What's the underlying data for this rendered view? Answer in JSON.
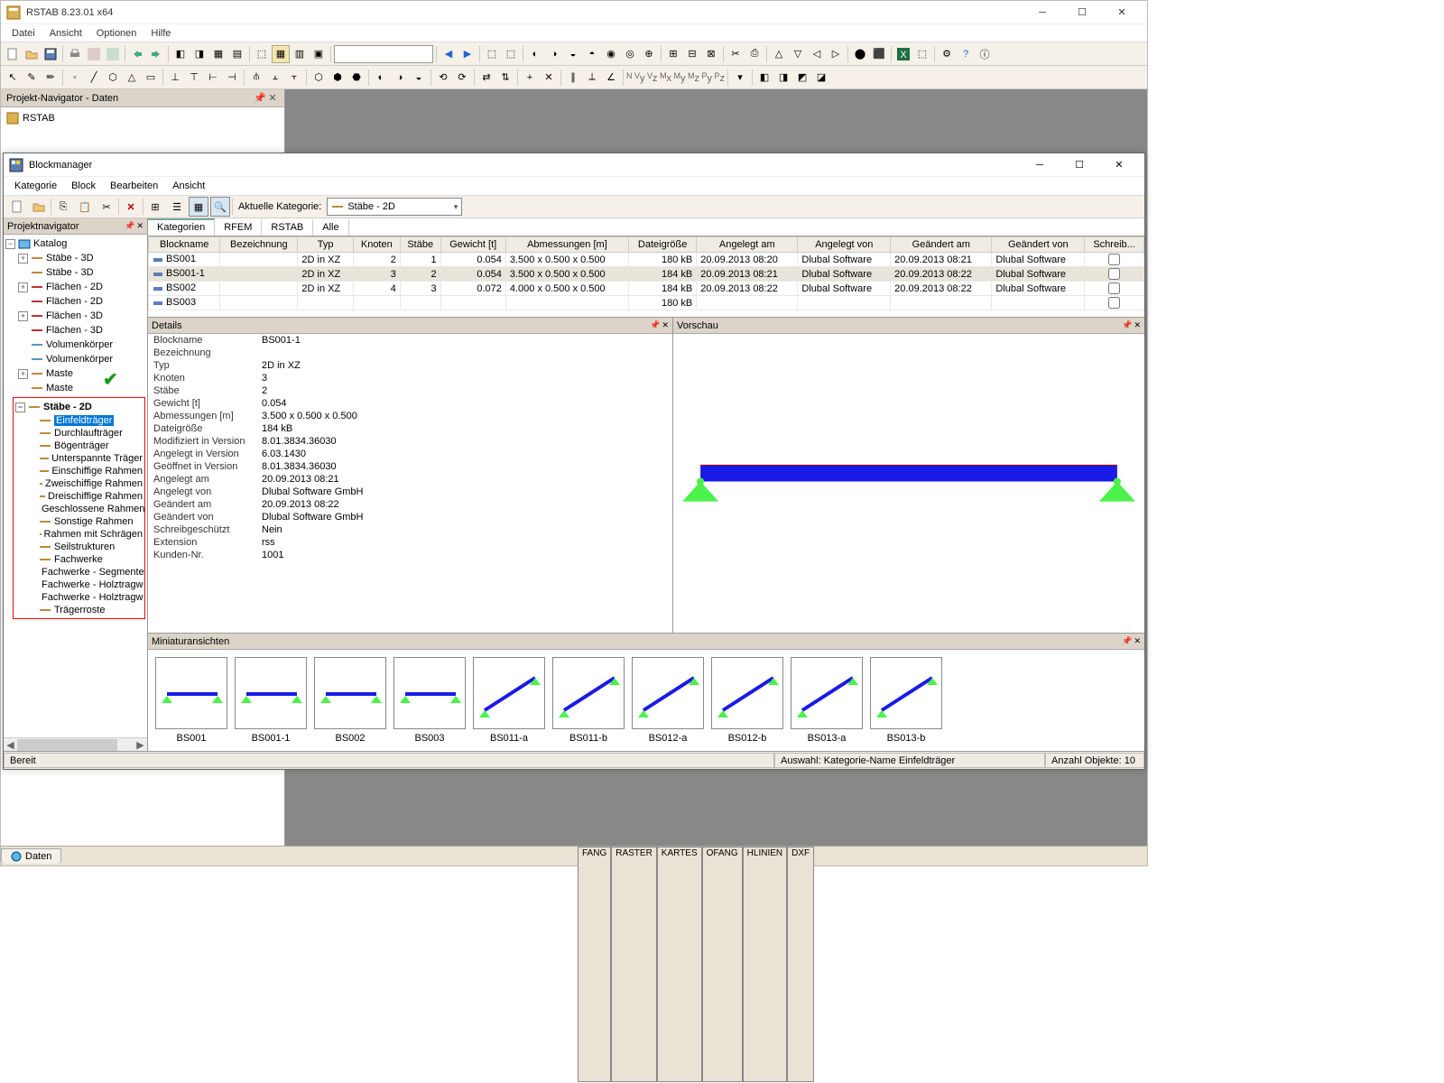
{
  "app": {
    "title": "RSTAB 8.23.01 x64",
    "menus": [
      "Datei",
      "Ansicht",
      "Optionen",
      "Hilfe"
    ],
    "navigator_title": "Projekt-Navigator - Daten",
    "nav_root": "RSTAB",
    "footer_tab": "Daten",
    "status_toggles": [
      "FANG",
      "RASTER",
      "KARTES",
      "OFANG",
      "HLINIEN",
      "DXF"
    ]
  },
  "bm": {
    "title": "Blockmanager",
    "menus": [
      "Kategorie",
      "Block",
      "Bearbeiten",
      "Ansicht"
    ],
    "toolbar_label": "Aktuelle Kategorie:",
    "toolbar_category": "Stäbe - 2D",
    "left_header": "Projektnavigator",
    "tree_root": "Katalog",
    "tree": [
      {
        "exp": "+",
        "label": "Stäbe - 3D",
        "color": "#c08a3a"
      },
      {
        "exp": "",
        "label": "Stäbe - 3D",
        "color": "#c08a3a"
      },
      {
        "exp": "+",
        "label": "Flächen - 2D",
        "color": "#b33"
      },
      {
        "exp": "",
        "label": "Flächen - 2D",
        "color": "#b33"
      },
      {
        "exp": "+",
        "label": "Flächen - 3D",
        "color": "#b33"
      },
      {
        "exp": "",
        "label": "Flächen - 3D",
        "color": "#b33"
      },
      {
        "exp": "",
        "label": "Volumenkörper",
        "color": "#59b"
      },
      {
        "exp": "",
        "label": "Volumenkörper",
        "color": "#59b"
      },
      {
        "exp": "+",
        "label": "Maste",
        "color": "#c08a3a"
      },
      {
        "exp": "",
        "label": "Maste",
        "color": "#c08a3a"
      }
    ],
    "red_group_label": "Stäbe - 2D",
    "red_group": [
      {
        "label": "Einfeldträger",
        "selected": true
      },
      {
        "label": "Durchlaufträger"
      },
      {
        "label": "Bögenträger"
      },
      {
        "label": "Unterspannte Träger"
      },
      {
        "label": "Einschiffige Rahmen"
      },
      {
        "label": "Zweischiffige Rahmen"
      },
      {
        "label": "Dreischiffige Rahmen"
      },
      {
        "label": "Geschlossene Rahmen"
      },
      {
        "label": "Sonstige Rahmen"
      },
      {
        "label": "Rahmen mit Schrägen"
      },
      {
        "label": "Seilstrukturen"
      },
      {
        "label": "Fachwerke"
      },
      {
        "label": "Fachwerke - Segmente"
      },
      {
        "label": "Fachwerke - Holztragw"
      },
      {
        "label": "Fachwerke - Holztragw"
      },
      {
        "label": "Trägerroste"
      }
    ],
    "tabs": [
      "Kategorien",
      "RFEM",
      "RSTAB",
      "Alle"
    ],
    "active_tab": 0,
    "grid_headers": [
      "Blockname",
      "Bezeichnung",
      "Typ",
      "Knoten",
      "Stäbe",
      "Gewicht [t]",
      "Abmessungen [m]",
      "Dateigröße",
      "Angelegt am",
      "Angelegt von",
      "Geändert am",
      "Geändert von",
      "Schreib..."
    ],
    "grid_rows": [
      {
        "name": "BS001",
        "typ": "2D in XZ",
        "knoten": "2",
        "stabe": "1",
        "gew": "0.054",
        "abm": "3.500 x 0.500 x 0.500",
        "size": "180 kB",
        "c_am": "20.09.2013 08:20",
        "c_von": "Dlubal Software",
        "m_am": "20.09.2013 08:21",
        "m_von": "Dlubal Software"
      },
      {
        "name": "BS001-1",
        "typ": "2D in XZ",
        "knoten": "3",
        "stabe": "2",
        "gew": "0.054",
        "abm": "3.500 x 0.500 x 0.500",
        "size": "184 kB",
        "c_am": "20.09.2013 08:21",
        "c_von": "Dlubal Software",
        "m_am": "20.09.2013 08:22",
        "m_von": "Dlubal Software",
        "sel": true
      },
      {
        "name": "BS002",
        "typ": "2D in XZ",
        "knoten": "4",
        "stabe": "3",
        "gew": "0.072",
        "abm": "4.000 x 0.500 x 0.500",
        "size": "184 kB",
        "c_am": "20.09.2013 08:22",
        "c_von": "Dlubal Software",
        "m_am": "20.09.2013 08:22",
        "m_von": "Dlubal Software"
      },
      {
        "name": "BS003",
        "typ": "",
        "knoten": "",
        "stabe": "",
        "gew": "",
        "abm": "",
        "size": "180 kB",
        "c_am": "",
        "c_von": "",
        "m_am": "",
        "m_von": ""
      }
    ],
    "details_header": "Details",
    "details": [
      [
        "Blockname",
        "BS001-1"
      ],
      [
        "Bezeichnung",
        ""
      ],
      [
        "Typ",
        "2D in XZ"
      ],
      [
        "Knoten",
        "3"
      ],
      [
        "Stäbe",
        "2"
      ],
      [
        "Gewicht [t]",
        "0.054"
      ],
      [
        "Abmessungen [m]",
        "3.500 x 0.500 x 0.500"
      ],
      [
        "Dateigröße",
        "184 kB"
      ],
      [
        "Modifiziert in Version",
        "8.01.3834.36030"
      ],
      [
        "Angelegt in Version",
        "6.03.1430"
      ],
      [
        "Geöffnet in Version",
        "8.01.3834.36030"
      ],
      [
        "Angelegt am",
        "20.09.2013 08:21"
      ],
      [
        "Angelegt von",
        "Dlubal Software GmbH"
      ],
      [
        "Geändert am",
        "20.09.2013 08:22"
      ],
      [
        "Geändert von",
        "Dlubal Software GmbH"
      ],
      [
        "Schreibgeschützt",
        "Nein"
      ],
      [
        "Extension",
        "rss"
      ],
      [
        "Kunden-Nr.",
        "1001"
      ]
    ],
    "preview_header": "Vorschau",
    "thumbs_header": "Miniaturansichten",
    "thumbs": [
      "BS001",
      "BS001-1",
      "BS002",
      "BS003",
      "BS011-a",
      "BS011-b",
      "BS012-a",
      "BS012-b",
      "BS013-a",
      "BS013-b"
    ],
    "status_left": "Bereit",
    "status_mid": "Auswahl: Kategorie-Name Einfeldträger",
    "status_right": "Anzahl Objekte: 10"
  }
}
